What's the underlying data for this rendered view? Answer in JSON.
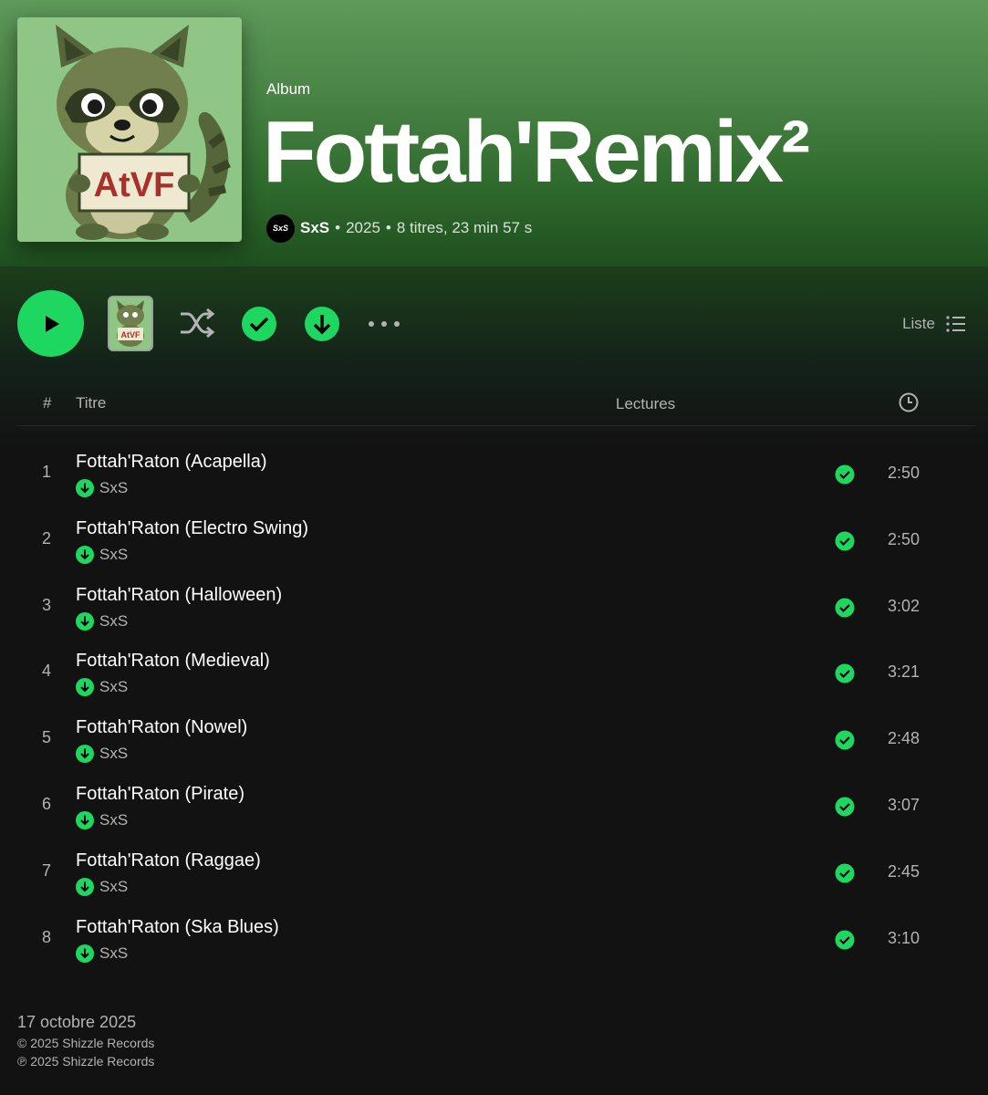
{
  "album": {
    "type_label": "Album",
    "title": "Fottah'Remix²",
    "cover_text": "AtVF",
    "artist_avatar_text": "SxS",
    "artist": "SxS",
    "year": "2025",
    "track_count_duration": "8 titres, 23 min 57 s",
    "separator": "•"
  },
  "controls": {
    "play_icon": "play-icon",
    "shuffle_icon": "shuffle-icon",
    "saved_icon": "check-circle-icon",
    "download_icon": "download-icon",
    "more_icon": "more-horizontal-icon",
    "view_label": "Liste",
    "view_icon": "list-icon"
  },
  "table": {
    "col_num": "#",
    "col_title": "Titre",
    "col_plays": "Lectures",
    "col_duration_icon": "clock-icon"
  },
  "tracks": [
    {
      "num": "1",
      "title": "Fottah'Raton (Acapella)",
      "artist": "SxS",
      "duration": "2:50"
    },
    {
      "num": "2",
      "title": "Fottah'Raton (Electro Swing)",
      "artist": "SxS",
      "duration": "2:50"
    },
    {
      "num": "3",
      "title": "Fottah'Raton (Halloween)",
      "artist": "SxS",
      "duration": "3:02"
    },
    {
      "num": "4",
      "title": "Fottah'Raton (Medieval)",
      "artist": "SxS",
      "duration": "3:21"
    },
    {
      "num": "5",
      "title": "Fottah'Raton (Nowel)",
      "artist": "SxS",
      "duration": "2:48"
    },
    {
      "num": "6",
      "title": "Fottah'Raton (Pirate)",
      "artist": "SxS",
      "duration": "3:07"
    },
    {
      "num": "7",
      "title": "Fottah'Raton (Raggae)",
      "artist": "SxS",
      "duration": "2:45"
    },
    {
      "num": "8",
      "title": "Fottah'Raton (Ska Blues)",
      "artist": "SxS",
      "duration": "3:10"
    }
  ],
  "footer": {
    "release_date": "17 octobre 2025",
    "copyright": "© 2025 Shizzle Records",
    "phonogram": "℗ 2025 Shizzle Records"
  },
  "colors": {
    "accent": "#1ed760",
    "background": "#121212",
    "header_green": "#4a8446"
  }
}
